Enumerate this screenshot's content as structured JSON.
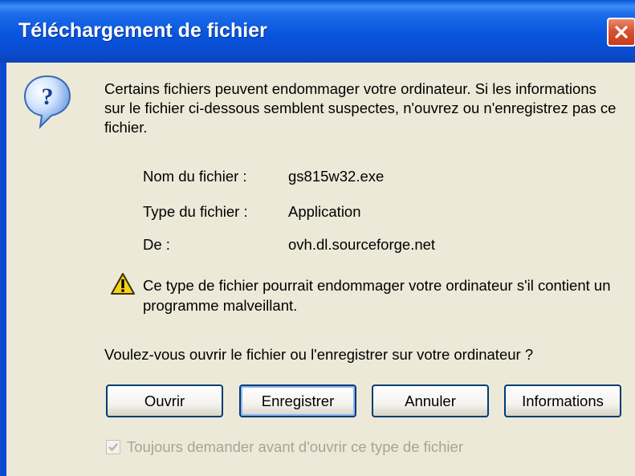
{
  "window": {
    "title": "Téléchargement de fichier"
  },
  "message": {
    "intro": "Certains fichiers peuvent endommager votre ordinateur. Si les informations sur le fichier ci-dessous semblent suspectes, n'ouvrez ou n'enregistrez pas ce fichier."
  },
  "file_info": [
    {
      "label": "Nom du fichier :",
      "value": "gs815w32.exe"
    },
    {
      "label": "Type du fichier :",
      "value": "Application"
    },
    {
      "label": "De :",
      "value": "ovh.dl.sourceforge.net"
    }
  ],
  "warning": {
    "text": "Ce type de fichier pourrait endommager votre ordinateur s'il contient un programme malveillant."
  },
  "question": "Voulez-vous ouvrir le fichier ou l'enregistrer sur votre ordinateur ?",
  "buttons": {
    "open": "Ouvrir",
    "save": "Enregistrer",
    "cancel": "Annuler",
    "info": "Informations"
  },
  "checkbox": {
    "label": "Toujours demander avant d'ouvrir ce type de fichier",
    "checked": true,
    "disabled": true
  },
  "icons": {
    "question": "question-icon",
    "warning": "warning-icon",
    "close": "close-icon"
  },
  "colors": {
    "titlebar": "#0a4bd0",
    "close_button": "#d6532f",
    "dialog_background": "#ece9d8",
    "button_border": "#003c74"
  }
}
